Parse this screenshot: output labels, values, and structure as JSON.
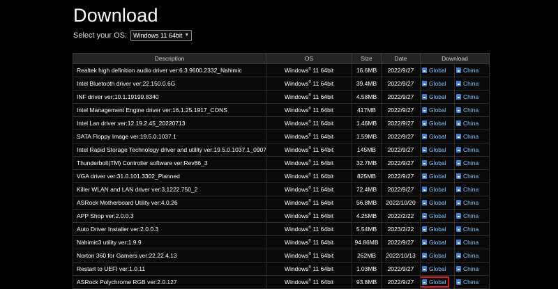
{
  "page": {
    "title": "Download"
  },
  "os_selector": {
    "label": "Select your OS:",
    "selected": "Windows 11 64bit"
  },
  "table": {
    "headers": {
      "description": "Description",
      "os": "OS",
      "size": "Size",
      "date": "Date",
      "download": "Download"
    },
    "os_name": "Windows",
    "os_reg": "®",
    "os_version": " 11 64bit",
    "global_label": "Global",
    "china_label": "China",
    "highlighted_row": 17,
    "rows": [
      {
        "description": "Realtek high definition audio driver ver:6.3.9600.2332_Nahimic",
        "size": "16.6MB",
        "date": "2022/9/27"
      },
      {
        "description": "Intel Bluetooth driver ver:22.150.0.6G",
        "size": "39.4MB",
        "date": "2022/9/27"
      },
      {
        "description": "INF driver ver:10.1.19199.8340",
        "size": "4.58MB",
        "date": "2022/9/27"
      },
      {
        "description": "Intel Management Engine driver ver:16.1.25.1917_CONS",
        "size": "417MB",
        "date": "2022/9/27"
      },
      {
        "description": "Intel Lan driver ver:12.19.2.45_20220713",
        "size": "1.46MB",
        "date": "2022/9/27"
      },
      {
        "description": "SATA Floppy Image ver:19.5.0.1037.1",
        "size": "1.59MB",
        "date": "2022/9/27"
      },
      {
        "description": "Intel Rapid Storage Technology driver and utility ver:19.5.0.1037.1_0907",
        "size": "145MB",
        "date": "2022/9/27"
      },
      {
        "description": "Thunderbolt(TM) Controller software ver:Rev86_3",
        "size": "32.7MB",
        "date": "2022/9/27"
      },
      {
        "description": "VGA driver ver:31.0.101.3302_Planned",
        "size": "825MB",
        "date": "2022/9/27"
      },
      {
        "description": "Killer WLAN and LAN driver ver:3.1222.750_2",
        "size": "72.4MB",
        "date": "2022/9/27"
      },
      {
        "description": "ASRock Motherboard Utility ver:4.0.26",
        "size": "56.8MB",
        "date": "2022/10/20"
      },
      {
        "description": "APP Shop ver:2.0.0.3",
        "size": "4.25MB",
        "date": "2022/2/22"
      },
      {
        "description": "Auto Driver Installer ver:2.0.0.3",
        "size": "5.54MB",
        "date": "2023/2/22"
      },
      {
        "description": "Nahimic3 utility ver:1.9.9",
        "size": "94.86MB",
        "date": "2022/9/27"
      },
      {
        "description": "Norton 360 for Gamers ver:22.22.4.13",
        "size": "262MB",
        "date": "2022/10/13"
      },
      {
        "description": "Restart to UEFI ver:1.0.11",
        "size": "1.03MB",
        "date": "2022/9/27"
      },
      {
        "description": "ASRock Polychrome RGB ver:2.0.127",
        "size": "93.8MB",
        "date": "2022/9/27"
      }
    ]
  }
}
